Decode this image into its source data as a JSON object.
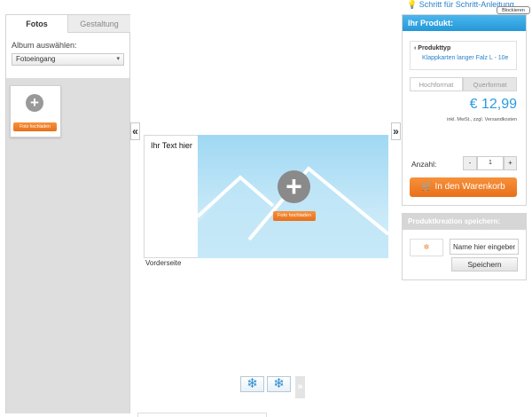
{
  "left_panel": {
    "tabs": [
      {
        "label": "Fotos"
      },
      {
        "label": "Gestaltung"
      }
    ],
    "album_label": "Album auswählen:",
    "album_selected": "Fotoeingang",
    "thumb_upload_label": "Foto hochladen"
  },
  "editor": {
    "left_arrow": "«",
    "right_arrow": "»",
    "text_placeholder": "Ihr Text hier",
    "upload_label": "Foto hochladen",
    "side_label": "Vorderseite",
    "next_side": "»"
  },
  "top": {
    "guide_link": "Schritt für Schritt-Anleitung",
    "block_button": "Blockieren"
  },
  "product": {
    "header": "Ihr Produkt:",
    "type_label": "Produkttyp",
    "type_value": "Klappkarten langer Falz L - 10e",
    "formats": [
      "Hochformat",
      "Querformat"
    ],
    "price": "€ 12,99",
    "tax_note": "inkl. MwSt., zzgl. Versandkosten",
    "quantity_label": "Anzahl:",
    "quantity": "1",
    "minus": "-",
    "plus": "+",
    "cart_button": "In den Warenkorb"
  },
  "save": {
    "header": "Produktkreation speichern:",
    "name_placeholder": "Name hier eingeben",
    "save_button": "Speichern"
  },
  "colors": {
    "accent_blue": "#2598d8",
    "orange": "#f0801f"
  }
}
